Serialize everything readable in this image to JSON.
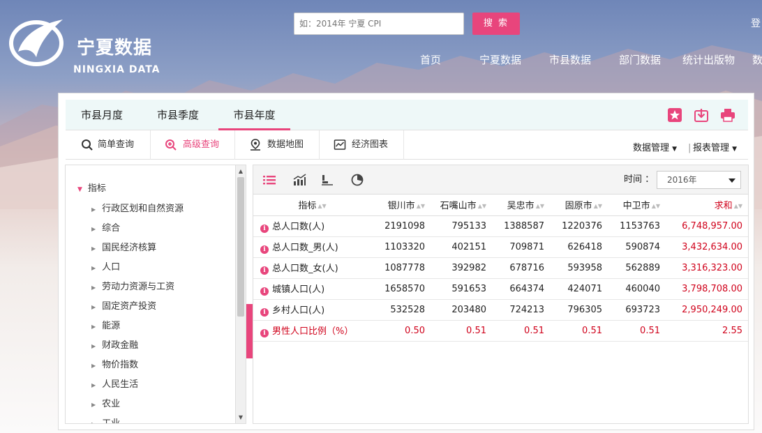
{
  "brand": {
    "name_cn": "宁夏数据",
    "name_en": "NINGXIA DATA",
    "accent": "#e8457c"
  },
  "search": {
    "placeholder": "如：2014年 宁夏 CPI",
    "button": "搜 索"
  },
  "login": "登",
  "nav": [
    "首页",
    "宁夏数据",
    "市县数据",
    "部门数据",
    "统计出版物",
    "数"
  ],
  "tabs": [
    {
      "label": "市县月度",
      "active": false
    },
    {
      "label": "市县季度",
      "active": false
    },
    {
      "label": "市县年度",
      "active": true
    }
  ],
  "top_icons": [
    "star-icon",
    "download-icon",
    "print-icon"
  ],
  "toolbar": {
    "items": [
      {
        "label": "简单查询",
        "icon": "search-icon",
        "active": false
      },
      {
        "label": "高级查询",
        "icon": "zoom-in-icon",
        "active": true
      },
      {
        "label": "数据地图",
        "icon": "map-pin-icon",
        "active": false
      },
      {
        "label": "经济图表",
        "icon": "chart-icon",
        "active": false
      }
    ],
    "data_manage": "数据管理",
    "report_manage": "报表管理"
  },
  "tree": {
    "root": "指标",
    "items": [
      "行政区划和自然资源",
      "综合",
      "国民经济核算",
      "人口",
      "劳动力资源与工资",
      "固定资产投资",
      "能源",
      "财政金融",
      "物价指数",
      "人民生活",
      "农业",
      "工业"
    ]
  },
  "view_icons": [
    "list-icon",
    "line-chart-icon",
    "bar-chart-icon",
    "pie-chart-icon"
  ],
  "time": {
    "label": "时间",
    "colon": "：",
    "value": "2016年"
  },
  "table": {
    "headers": [
      "指标",
      "银川市",
      "石嘴山市",
      "吴忠市",
      "固原市",
      "中卫市",
      "求和"
    ],
    "rows": [
      [
        "总人口数(人)",
        "2191098",
        "795133",
        "1388587",
        "1220376",
        "1153763",
        "6,748,957.00"
      ],
      [
        "总人口数_男(人)",
        "1103320",
        "402151",
        "709871",
        "626418",
        "590874",
        "3,432,634.00"
      ],
      [
        "总人口数_女(人)",
        "1087778",
        "392982",
        "678716",
        "593958",
        "562889",
        "3,316,323.00"
      ],
      [
        "城镇人口(人)",
        "1658570",
        "591653",
        "664374",
        "424071",
        "460040",
        "3,798,708.00"
      ],
      [
        "乡村人口(人)",
        "532528",
        "203480",
        "724213",
        "796305",
        "693723",
        "2,950,249.00"
      ],
      [
        "男性人口比例（%）",
        "0.50",
        "0.51",
        "0.51",
        "0.51",
        "0.51",
        "2.55"
      ]
    ]
  }
}
